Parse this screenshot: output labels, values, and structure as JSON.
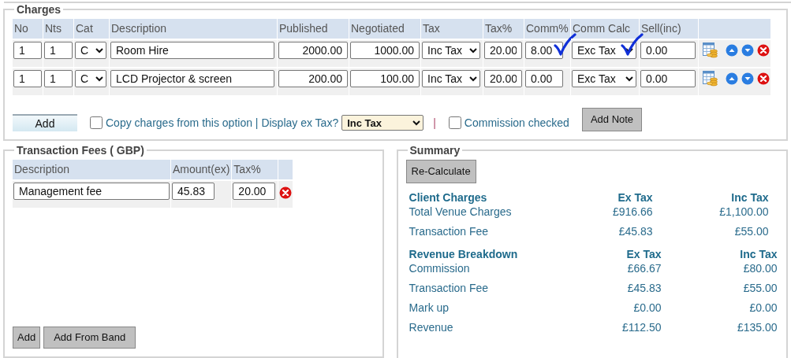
{
  "charges": {
    "title": "Charges",
    "columns": [
      "No",
      "Nts",
      "Cat",
      "Description",
      "Published",
      "Negotiated",
      "Tax",
      "Tax%",
      "Comm%",
      "Comm Calc",
      "Sell(inc)"
    ],
    "rows": [
      {
        "no": "1",
        "nts": "1",
        "cat": "C",
        "description": "Room Hire",
        "published": "2000.00",
        "negotiated": "1000.00",
        "tax": "Inc Tax",
        "tax_percent": "20.00",
        "comm_percent": "8.00",
        "comm_calc": "Exc Tax",
        "sell_inc": "0.00",
        "comm_ticked": true,
        "calc_ticked": true
      },
      {
        "no": "1",
        "nts": "1",
        "cat": "C",
        "description": "LCD Projector & screen",
        "published": "200.00",
        "negotiated": "100.00",
        "tax": "Inc Tax",
        "tax_percent": "20.00",
        "comm_percent": "0.00",
        "comm_calc": "Exc Tax",
        "sell_inc": "0.00",
        "comm_ticked": false,
        "calc_ticked": false
      }
    ],
    "add_button": "Add",
    "copy_option": {
      "label": "Copy charges from this option | Display ex Tax?",
      "checked": false
    },
    "display_tax": "Inc Tax",
    "separator": "|",
    "commission_checked": {
      "label": "Commission checked",
      "checked": false
    },
    "add_note_button": "Add Note"
  },
  "transaction_fees": {
    "title": "Transaction Fees ( GBP)",
    "columns": [
      "Description",
      "Amount(ex)",
      "Tax%"
    ],
    "rows": [
      {
        "description": "Management fee",
        "amount_ex": "45.83",
        "tax_percent": "20.00"
      }
    ],
    "buttons": [
      "Add",
      "Add From Band"
    ]
  },
  "summary": {
    "title": "Summary",
    "recalculate_button": "Re-Calculate",
    "sections": [
      {
        "heading": "Client Charges",
        "ex_header": "Ex Tax",
        "inc_header": "Inc Tax",
        "rows": [
          {
            "label": "Total Venue Charges",
            "ex": "£916.66",
            "inc": "£1,100.00"
          },
          {
            "label": "Transaction Fee",
            "ex": "£45.83",
            "inc": "£55.00"
          }
        ]
      },
      {
        "heading": "Revenue Breakdown",
        "ex_header": "Ex Tax",
        "inc_header": "Inc Tax",
        "rows": [
          {
            "label": "Commission",
            "ex": "£66.67",
            "inc": "£80.00"
          },
          {
            "label": "Transaction Fee",
            "ex": "£45.83",
            "inc": "£55.00"
          },
          {
            "label": "Mark up",
            "ex": "£0.00",
            "inc": "£0.00"
          },
          {
            "label": "Revenue",
            "ex": "£112.50",
            "inc": "£135.00"
          }
        ]
      }
    ]
  }
}
